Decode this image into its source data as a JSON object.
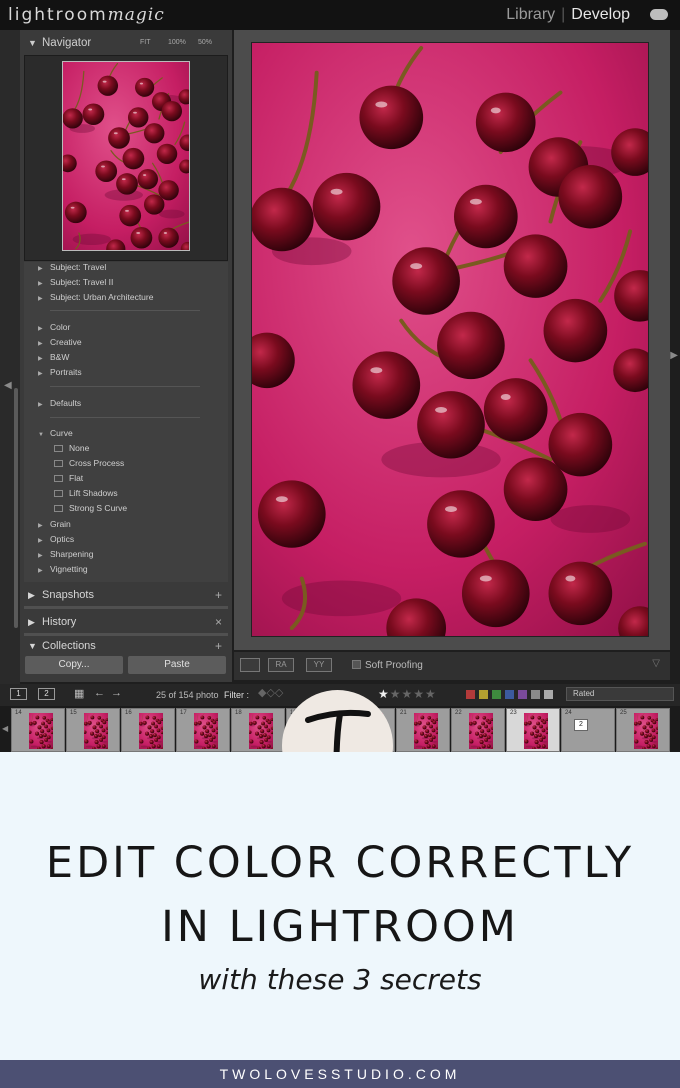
{
  "app": {
    "logo_main": "lightroom",
    "logo_accent": "magic",
    "modules": [
      "Library",
      "Develop"
    ],
    "active_module": "Develop",
    "icons": [
      "cloud-icon"
    ]
  },
  "navigator": {
    "title": "Navigator",
    "zoom_options": [
      "FIT",
      "100%",
      "50%"
    ]
  },
  "presets": {
    "subjects": [
      "Subject: Travel",
      "Subject: Travel II",
      "Subject: Urban Architecture"
    ],
    "groups": [
      "Color",
      "Creative",
      "B&W",
      "Portraits"
    ],
    "defaults": "Defaults",
    "curve_group": "Curve",
    "curve_items": [
      "None",
      "Cross Process",
      "Flat",
      "Lift Shadows",
      "Strong S Curve"
    ],
    "more_groups": [
      "Grain",
      "Optics",
      "Sharpening",
      "Vignetting"
    ]
  },
  "panels": {
    "snapshots": "Snapshots",
    "snapshots_action": "+",
    "history": "History",
    "history_action": "×",
    "collections": "Collections",
    "collections_action": "+"
  },
  "buttons": {
    "copy": "Copy...",
    "paste": "Paste"
  },
  "toolbar": {
    "view_label": "",
    "before_after": "RA",
    "compare": "YY",
    "soft_proofing": "Soft Proofing"
  },
  "filmbar": {
    "screen1": "1",
    "screen2": "2",
    "count": "25 of 154 photo",
    "filter_label": "Filter :",
    "rating_value": 1,
    "rating_max": 5,
    "filter_value": "Rated",
    "label_colors": [
      "#b33a3a",
      "#b3a030",
      "#3e8a3e",
      "#3c5a9e",
      "#7a4a9a",
      "#8a8a8a",
      "#aaaaaa"
    ]
  },
  "filmstrip": {
    "indices": [
      "14",
      "15",
      "16",
      "17",
      "18",
      "19",
      "20",
      "21",
      "22",
      "23",
      "24",
      "25"
    ],
    "selected_badge": "2"
  },
  "brand_letter": "T",
  "promo": {
    "line1": "EDIT COLOR CORRECTLY",
    "line2": "IN LIGHTROOM",
    "subtitle": "with these 3 secrets",
    "footer": "TWOLOVESSTUDIO.COM"
  },
  "colors": {
    "promo_bg": "#eef7fc",
    "footer_bg": "#4c5073",
    "photo_pink": "#c2185b",
    "cherry": "#7a0b1e"
  }
}
